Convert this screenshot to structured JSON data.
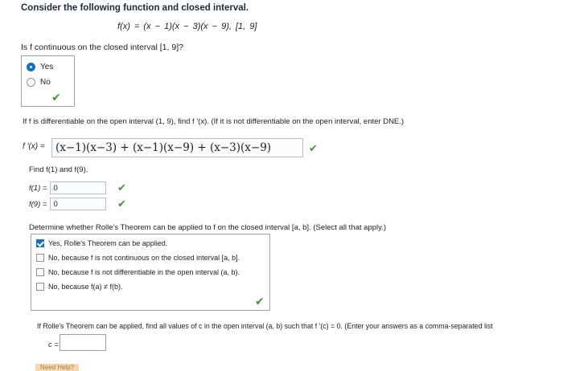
{
  "question": {
    "title": "Consider the following function and closed interval.",
    "function": "f(x) = (x − 1)(x − 3)(x − 9),   [1, 9]"
  },
  "continuity": {
    "question": "Is f continuous on the closed interval [1, 9]?",
    "options": [
      {
        "label": "Yes",
        "selected": true
      },
      {
        "label": "No",
        "selected": false
      }
    ]
  },
  "differentiability": {
    "question": "If f is differentiable on the open interval (1, 9), find f '(x). (If it is not differentiable on the open interval, enter DNE.)",
    "label": "f '(x) =",
    "answer": "(x−1)(x−3) + (x−1)(x−9) + (x−3)(x−9)"
  },
  "endpoints": {
    "prompt": "Find f(1) and f(9).",
    "f1_label": "f(1) =",
    "f1_value": "0",
    "f9_label": "f(9) =",
    "f9_value": "0"
  },
  "rolle": {
    "question": "Determine whether Rolle's Theorem can be applied to f on the closed interval [a, b]. (Select all that apply.)",
    "options": [
      {
        "label": "Yes, Rolle's Theorem can be applied.",
        "selected": true
      },
      {
        "label": "No, because f is not continuous on the closed interval [a, b].",
        "selected": false
      },
      {
        "label": "No, because f is not differentiable in the open interval (a, b).",
        "selected": false
      },
      {
        "label": "No, because f(a) ≠ f(b).",
        "selected": false
      }
    ]
  },
  "final": {
    "question": "If Rolle's Theorem can be applied, find all values of c in the open interval (a, b) such that f '(c) = 0. (Enter your answers as a comma-separated list",
    "c_label": "c =",
    "c_value": ""
  },
  "help": {
    "label": "Need Help?"
  },
  "colors": {
    "accent": "#1a6fc0",
    "correct": "#3a9a2c"
  },
  "icons": [
    "radio-selected-icon",
    "check-icon",
    "checkbox-checked-icon"
  ]
}
